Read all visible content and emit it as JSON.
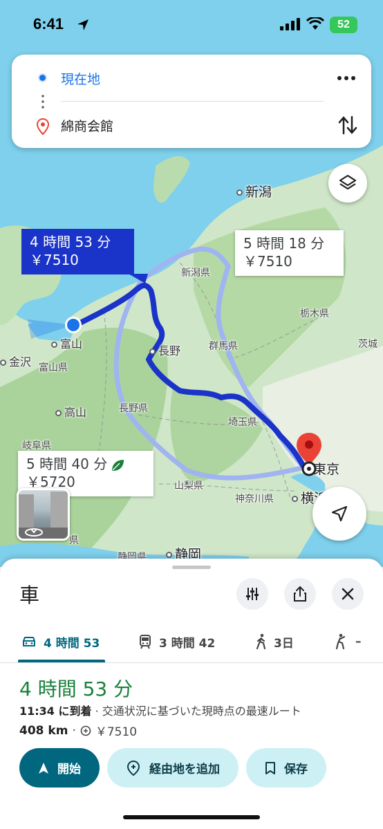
{
  "status_bar": {
    "time": "6:41",
    "battery": "52"
  },
  "search": {
    "origin": "現在地",
    "destination": "綿商会館"
  },
  "map": {
    "route_bubbles": [
      {
        "line1": "4 時間 53 分",
        "line2": "￥7510"
      },
      {
        "line1": "5 時間 18 分",
        "line2": "￥7510"
      },
      {
        "line1": "5 時間 40 分",
        "line2": "￥5720"
      }
    ],
    "places": {
      "niigata": "新潟",
      "niigata_pref": "新潟県",
      "toyama": "富山",
      "toyama_pref": "富山県",
      "kanazawa": "金沢",
      "nagano": "長野",
      "nagano_pref": "長野県",
      "gunma_pref": "群馬県",
      "tochigi_pref": "栃木県",
      "ibaraki": "茨城",
      "takayama": "高山",
      "gifu_pref": "岐阜県",
      "saitama_pref": "埼玉県",
      "yamanashi_pref": "山梨県",
      "tokyo": "東京",
      "kanagawa_pref": "神奈川県",
      "yokohama": "横浜",
      "shizuoka_pref": "静岡県",
      "shizuoka": "静岡",
      "ken_fragment": "県"
    }
  },
  "sheet": {
    "title": "車",
    "tabs": [
      {
        "label": "4 時間 53",
        "icon": "car-icon",
        "active": true
      },
      {
        "label": "3 時間 42",
        "icon": "train-icon",
        "active": false
      },
      {
        "label": "3日",
        "icon": "walk-icon",
        "active": false
      },
      {
        "label": "–",
        "icon": "bike-icon",
        "active": false
      }
    ],
    "duration": "4 時間 53 分",
    "arrival_time": "11:34 に到着",
    "arrival_note": " · 交通状況に基づいた現時点の最速ルート",
    "distance": "408 km",
    "toll_separator": "·",
    "toll": "￥7510",
    "buttons": {
      "start": "開始",
      "add_stop": "経由地を追加",
      "save": "保存"
    }
  },
  "colors": {
    "accent": "#00677f",
    "route_selected": "#1a33c8",
    "route_alt": "#9fb4f0",
    "duration": "#188038"
  }
}
